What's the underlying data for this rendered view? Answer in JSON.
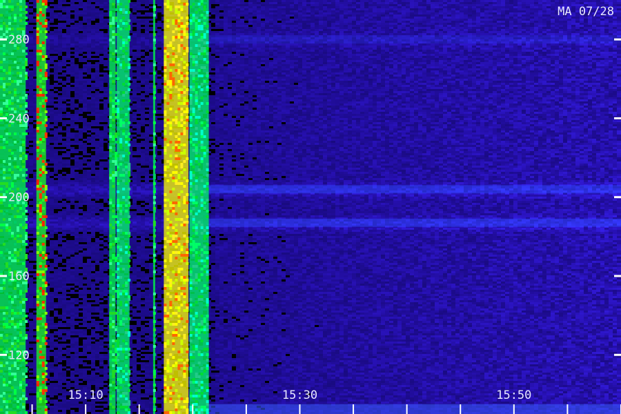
{
  "chart_data": {
    "type": "heatmap",
    "title": "MA 07/28",
    "xlabel": "",
    "ylabel": "",
    "x_range": [
      "15:02",
      "16:00"
    ],
    "y_range": [
      90,
      300
    ],
    "x_ticks": [
      "15:10",
      "15:30",
      "15:50"
    ],
    "x_tick_minutes": [
      8,
      28,
      48
    ],
    "y_ticks": [
      120,
      160,
      200,
      240,
      280
    ],
    "colorscale": [
      "#000000",
      "#1a0a8a",
      "#3322ff",
      "#00ffff",
      "#00ff00",
      "#ffff00",
      "#ff0000"
    ],
    "bright_bands_minutes": [
      {
        "start": 0.0,
        "end": 2.4,
        "level": "green"
      },
      {
        "start": 3.4,
        "end": 4.3,
        "level": "green-red"
      },
      {
        "start": 10.2,
        "end": 10.8,
        "level": "green"
      },
      {
        "start": 10.9,
        "end": 12.1,
        "level": "green-cyan"
      },
      {
        "start": 14.3,
        "end": 14.5,
        "level": "green"
      },
      {
        "start": 15.3,
        "end": 17.6,
        "level": "yellow-red"
      },
      {
        "start": 17.7,
        "end": 19.5,
        "level": "green-cyan"
      }
    ],
    "horizontal_bands_value": [
      {
        "value": 204,
        "strength": "medium"
      },
      {
        "value": 187,
        "strength": "medium"
      },
      {
        "value": 280,
        "strength": "low"
      }
    ]
  }
}
